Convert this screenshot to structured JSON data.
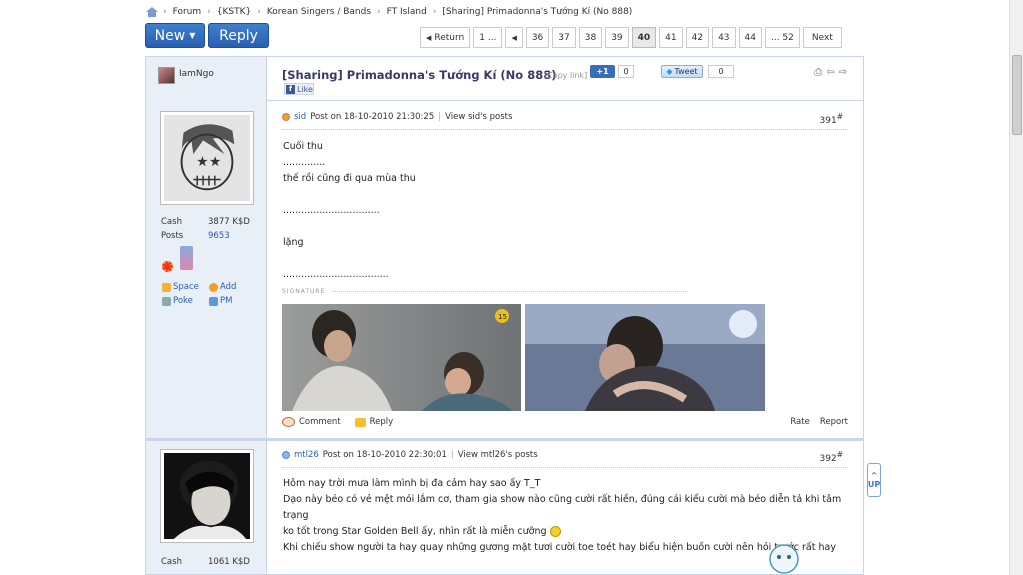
{
  "breadcrumb": [
    "Forum",
    "{KSTK}",
    "Korean Singers / Bands",
    "FT Island",
    "[Sharing] Primadonna's Tướng Kí (No 888)"
  ],
  "toolbar": {
    "new_label": "New",
    "reply_label": "Reply"
  },
  "pager": {
    "return": "Return",
    "first": "1 ...",
    "prev": "",
    "pages": [
      "36",
      "37",
      "38",
      "39",
      "40",
      "41",
      "42",
      "43",
      "44"
    ],
    "current": "40",
    "last": "... 52",
    "next": "Next"
  },
  "thread": {
    "starter": "IamNgo",
    "title": "[Sharing] Primadonna's Tướng Kí (No 888)",
    "copy_link": "[Copy link]",
    "gplus": "+1",
    "gplus_count": "0",
    "tweet": "Tweet",
    "tweet_count": "0",
    "fb_like": "Like"
  },
  "posts": [
    {
      "author": "sid",
      "meta": "Post on 18-10-2010 21:30:25",
      "view_posts": "View sid's posts",
      "number": "391",
      "cash_label": "Cash",
      "cash": "3877 K$D",
      "posts_label": "Posts",
      "posts": "9653",
      "links": [
        "Space",
        "Add",
        "Poke",
        "PM"
      ],
      "lines": [
        "Cuối thu",
        "..............",
        "thế rồi cũng đi qua mùa thu",
        "",
        "................................",
        "",
        "lặng",
        "",
        "..................................."
      ],
      "signature_label": "SIGNATURE",
      "comment": "Comment",
      "reply": "Reply",
      "rate": "Rate",
      "report": "Report"
    },
    {
      "author": "mtl26",
      "meta": "Post on 18-10-2010 22:30:01",
      "view_posts": "View mtl26's posts",
      "number": "392",
      "cash_label": "Cash",
      "cash": "1061 K$D",
      "lines": [
        "Hôm nay trời mưa làm mình bị đa cảm hay sao ấy T_T",
        "Dạo này béo có vẻ mệt mỏi lắm cơ, tham gia show nào cũng cười rất hiền, đúng cái kiểu cười mà béo diễn tả khi tâm trạng",
        "ko tốt trong Star Golden Bell ấy, nhìn rất là miễn cưỡng",
        "Khi chiếu show người ta hay quay những gương mặt tươi cười toe toét hay biểu hiện buồn cười nên hỏi trước rất hay"
      ]
    }
  ],
  "up_widget": "UP"
}
